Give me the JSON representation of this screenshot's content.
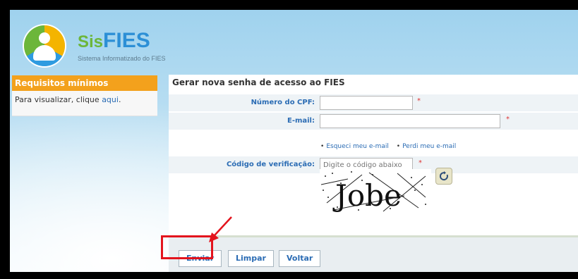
{
  "header": {
    "brand_prefix": "Sis",
    "brand_main": "FIES",
    "tagline": "Sistema Informatizado do FIES"
  },
  "sidebar": {
    "heading": "Requisitos mínimos",
    "text": "Para visualizar, clique",
    "link": "aqui",
    "suffix": "."
  },
  "form": {
    "title": "Gerar nova senha de acesso ao FIES",
    "cpf_label": "Número do CPF:",
    "cpf_value": "",
    "email_label": "E-mail:",
    "email_value": "",
    "required_mark": "*",
    "link_forgot_email": "Esqueci meu e-mail",
    "link_lost_email": "Perdi meu e-mail",
    "code_label": "Código de verificação:",
    "code_placeholder": "Digite o código abaixo",
    "captcha_text": "Jobe"
  },
  "buttons": {
    "send": "Enviar",
    "clear": "Limpar",
    "back": "Voltar"
  },
  "colors": {
    "accent": "#f3a11c",
    "link": "#2b6cb4",
    "highlight": "#e3141d"
  }
}
